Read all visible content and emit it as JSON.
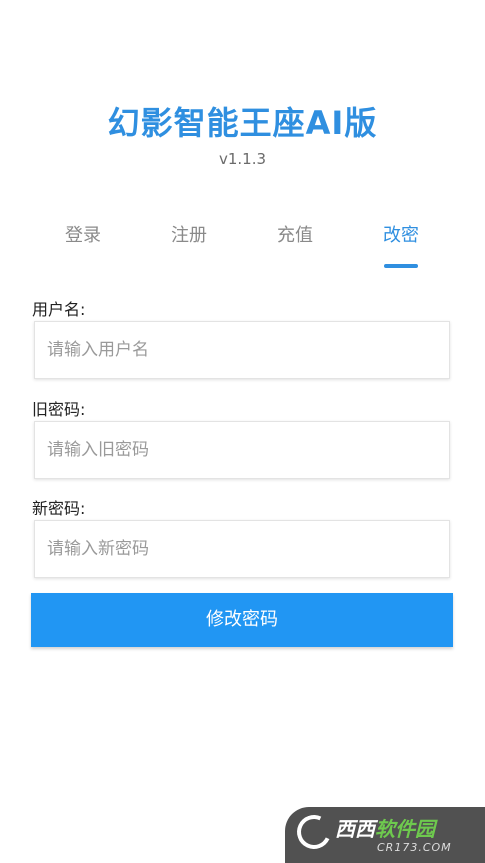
{
  "header": {
    "title": "幻影智能王座AI版",
    "version": "v1.1.3"
  },
  "tabs": [
    {
      "label": "登录",
      "active": false
    },
    {
      "label": "注册",
      "active": false
    },
    {
      "label": "充值",
      "active": false
    },
    {
      "label": "改密",
      "active": true
    }
  ],
  "form": {
    "username": {
      "label": "用户名:",
      "placeholder": "请输入用户名",
      "value": ""
    },
    "old_password": {
      "label": "旧密码:",
      "placeholder": "请输入旧密码",
      "value": ""
    },
    "new_password": {
      "label": "新密码:",
      "placeholder": "请输入新密码",
      "value": ""
    },
    "submit_label": "修改密码"
  },
  "colors": {
    "accent": "#2f8fe0",
    "button": "#2196f3",
    "tab_inactive": "#8a8a8a"
  },
  "watermark": {
    "main_a": "西西",
    "main_b": "软件园",
    "sub": "CR173.COM"
  }
}
